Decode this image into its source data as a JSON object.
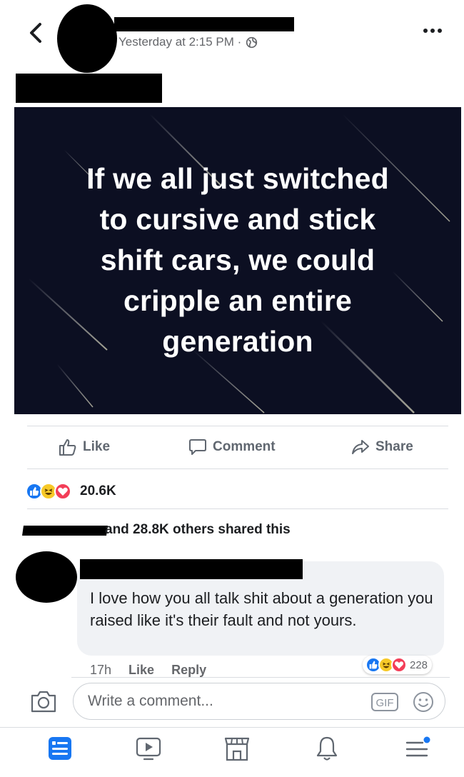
{
  "header": {
    "timestamp": "Yesterday at 2:15 PM ·",
    "privacy_icon": "globe-icon",
    "more_icon": "more-horizontal-icon",
    "back_icon": "chevron-left-icon"
  },
  "post": {
    "image_text": [
      "If we all just switched",
      "to cursive and stick",
      "shift cars, we could",
      "cripple an entire",
      "generation"
    ],
    "image_background": "#0c0f22"
  },
  "actions": {
    "like_label": "Like",
    "comment_label": "Comment",
    "share_label": "Share"
  },
  "reactions": {
    "icons": [
      "like-reaction-icon",
      "haha-reaction-icon",
      "love-reaction-icon"
    ],
    "count": "20.6K"
  },
  "shares": {
    "text": "and 28.8K others shared this"
  },
  "comment": {
    "text": "I love how you all talk shit about a generation you raised like it's their fault and not yours.",
    "time": "17h",
    "like_label": "Like",
    "reply_label": "Reply",
    "reaction_count": "228"
  },
  "composer": {
    "placeholder": "Write a comment...",
    "gif_label": "GIF"
  },
  "nav": {
    "items": [
      "news-feed-icon",
      "watch-icon",
      "marketplace-icon",
      "notifications-icon",
      "menu-icon"
    ]
  },
  "colors": {
    "accent": "#1877f2",
    "text_secondary": "#606770",
    "bubble": "#f0f2f5"
  }
}
